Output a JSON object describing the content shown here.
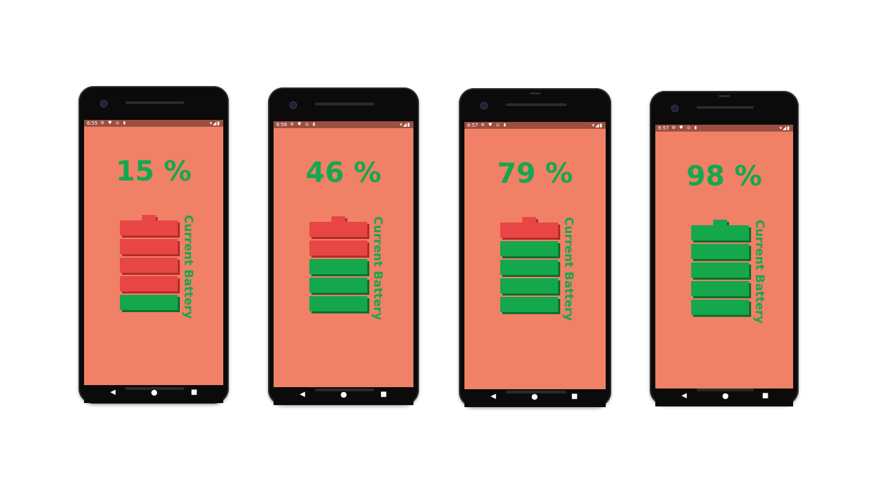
{
  "label": "Current Battery",
  "phones": [
    {
      "time": "6:55",
      "percent_text": "15 %",
      "level": 15,
      "cells": [
        "red",
        "red",
        "red",
        "red",
        "green"
      ],
      "tip": "red"
    },
    {
      "time": "6:56",
      "percent_text": "46 %",
      "level": 46,
      "cells": [
        "red",
        "red",
        "green",
        "green",
        "green"
      ],
      "tip": "red"
    },
    {
      "time": "6:57",
      "percent_text": "79 %",
      "level": 79,
      "cells": [
        "red",
        "green",
        "green",
        "green",
        "green"
      ],
      "tip": "red"
    },
    {
      "time": "6:57",
      "percent_text": "98 %",
      "level": 98,
      "cells": [
        "green",
        "green",
        "green",
        "green",
        "green"
      ],
      "tip": "green"
    }
  ],
  "status_icons": "⚙ ⛊ ◎ ▮",
  "status_right": "▾◢▮",
  "nav": {
    "back": "◀",
    "home": "●",
    "recent": "■"
  },
  "colors": {
    "screen_bg": "#f08066",
    "status_bar": "#9c4f40",
    "text_green": "#13a84f",
    "cell_red": "#e84545",
    "cell_green": "#14a74c"
  },
  "icons": [
    "settings-icon",
    "shield-icon",
    "data-saver-icon",
    "sd-card-icon",
    "wifi-icon",
    "signal-icon",
    "battery-icon",
    "back-icon",
    "home-icon",
    "recents-icon"
  ]
}
